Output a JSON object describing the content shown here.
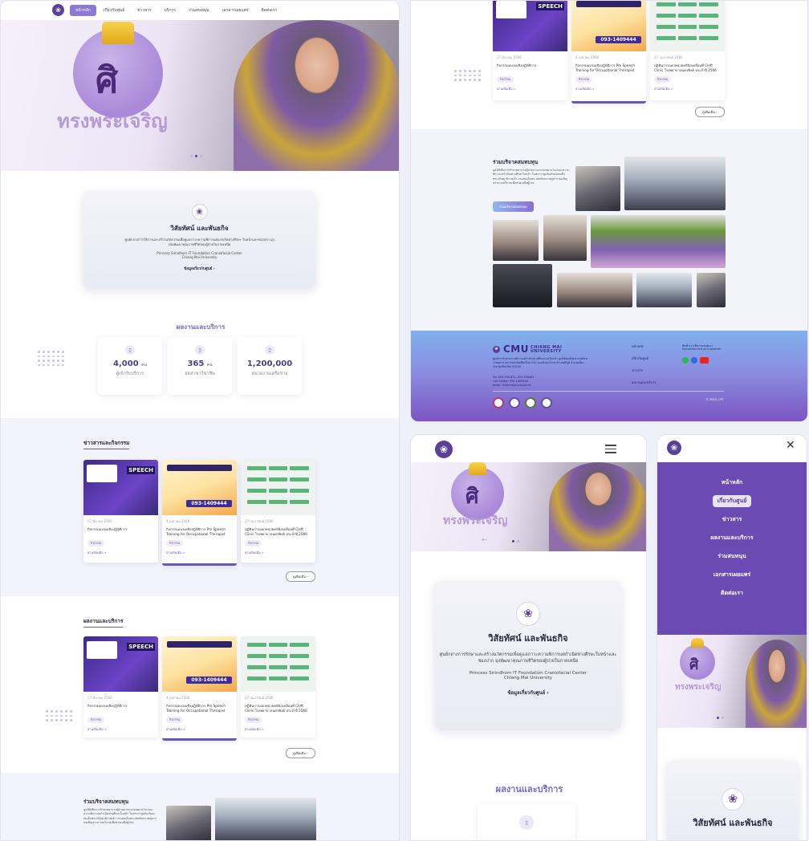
{
  "nav": {
    "items": [
      "หน้าหลัก",
      "เกี่ยวกับศูนย์",
      "ข่าวสาร",
      "บริการ",
      "ร่วมสนทนุน",
      "เอกสารเผยแพร่",
      "ติดต่อเรา"
    ]
  },
  "hero": {
    "monogram": "ศิ",
    "caption": "ทรงพระเจริญ"
  },
  "vision": {
    "title": "วิสัยทัศน์ และพันธกิจ",
    "desc": "ศูนย์กลางการให้การและสร้างนวัตกรรมเพื่อดูแลภาวะความพิการแต่แรกเกิดทางศีรษะ ใบหน้าและช่องปาก มุ่งเน้นพัฒนาคุณภาพชีวิตของผู้ป่วยในภาคเหนือ",
    "center_en": "Princess Sirindhorn IT Foundation Craniofacial Center",
    "univ_en": "Chiang Mai University",
    "more": "ข้อมูลเกี่ยวกับศูนย์",
    "desc_mobile": "ศูนย์กลางการรักษาและสร้างนวัตกรรมเพื่อดูแลภาวะความพิการแต่กำเนิดทางศีรษะใบหน้าและช่องปาก มุ่งพัฒนาคุณภาพชีวิตของผู้ป่วยในภาคเหนือ"
  },
  "stats": {
    "title": "ผลงานและบริการ",
    "items": [
      {
        "num": "4,000",
        "unit": "คน",
        "cap": "ผู้เข้ารับบริการ"
      },
      {
        "num": "365",
        "unit": "คน",
        "cap": "สหสาขาวิชาชีพ"
      },
      {
        "num": "1,200,000",
        "unit": "",
        "cap": "หน่วยงานเครือข่าย"
      }
    ]
  },
  "news": {
    "title": "ข่าวสารและกิจกรรม",
    "cards": [
      {
        "date": "27 มีนาคม 2566",
        "title": "กิจกรรมอบรมเชิงปฏิบัติการ",
        "tag": "กิจกรรม",
        "rm": "อ่านเพิ่มเติม >"
      },
      {
        "date": "4 เมษายน 2566",
        "title": "กิจกรรมอบรมเชิงปฏิบัติการ Pre Speech Training for Occupational Therapist",
        "tag": "กิจกรรม",
        "rm": "อ่านเพิ่มเติม >"
      },
      {
        "date": "27 กุมภาพันธ์ 2566",
        "title": "ปฏิทินการออกหน่วยคลินิกเคลื่อนที่ Cleft Clinic โรงพยาบาลนครพิงค์ ประจำปี 2566",
        "tag": "กิจกรรม",
        "rm": "อ่านเพิ่มเติม >"
      }
    ],
    "all": "ดูเพิ่มเติม"
  },
  "works": {
    "title": "ผลงานและบริการ"
  },
  "donate": {
    "title": "ร่วมบริจาคสมทบทุน",
    "desc": "มูลนิธิเพื่อการรักษาพยาบาลผู้ป่วยปากแหว่งเพดานโหว่และความพิการแต่กำเนิดทางศีรษะใบหน้า ในพระราชูปถัมภ์ของสมเด็จพระกนิษฐาธิราชเจ้า กรมสมเด็จพระเทพรัตนราชสุดาฯ ขอเชิญชวนร่วมบริจาคเพื่อช่วยเหลือผู้ป่วย",
    "btn": "ร่วมบริจาคสมทบทุน"
  },
  "footer": {
    "brand": "CMU",
    "brand_sub": "CHIANG MAI UNIVERSITY",
    "address": "ศูนย์การรักษาความพิการแต่กำเนิดทางศีรษะและใบหน้า มูลนิธิสมเด็จพระเทพรัตนราชสุดาฯ มหาวิทยาลัยเชียงใหม่ 110 ถนนอินทวโรรส ตำบลศรีภูมิ อำเภอเมือง จังหวัดเชียงใหม่ 50200",
    "tel": "Tel: 053-935-871, 053-934481",
    "call": "Call Center: 093-1409444",
    "email": "email: cleftcenter.cmu.ac.th",
    "links": [
      "หน้าหลัก",
      "เกี่ยวกับศูนย์",
      "ข่าวสาร",
      "ผลงานและบริการ"
    ],
    "social_title": "ติดต่ำเราเพื่อร่วมสนทนา",
    "social_sub": "Social/Service of Customer",
    "copy": "© 2023, CFC"
  },
  "mobile": {
    "menu": [
      "หน้าหลัก",
      "เกี่ยวกับศูนย์",
      "ข่าวสาร",
      "ผลงานและบริการ",
      "ร่วมสนทนุน",
      "เอกสารเผยแพร่",
      "ติดต่อเรา"
    ],
    "active_index": 1,
    "service_title": "ผลงานและบริการ"
  },
  "accent": "#5b3f98"
}
